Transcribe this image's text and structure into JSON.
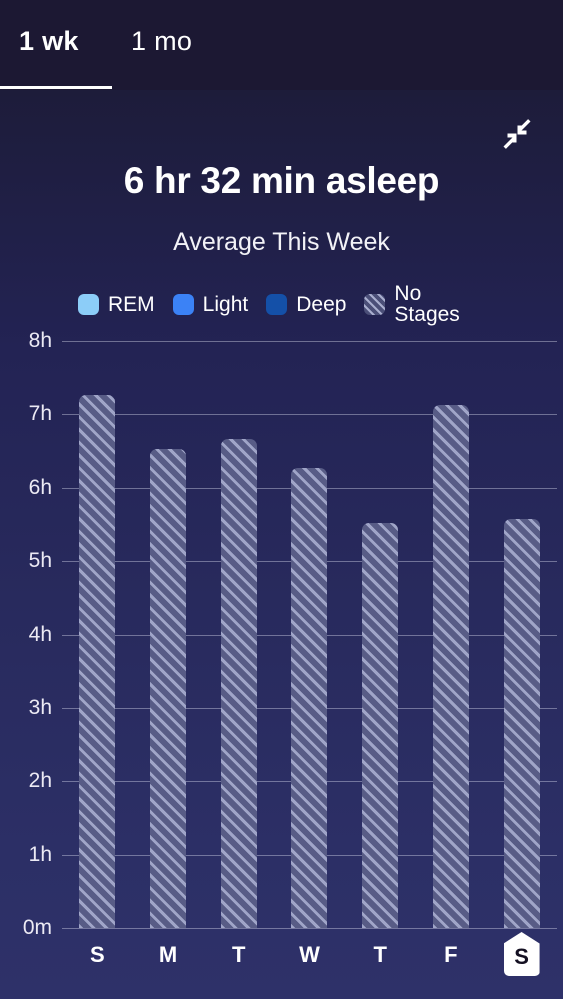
{
  "tabs": [
    {
      "label": "1 wk",
      "active": true
    },
    {
      "label": "1 mo",
      "active": false
    }
  ],
  "header": {
    "collapse_icon": "collapse-arrows-icon",
    "title": "6 hr 32 min asleep",
    "subtitle": "Average This Week"
  },
  "legend": [
    {
      "label": "REM",
      "color": "#8ccdf8",
      "pattern": "solid"
    },
    {
      "label": "Light",
      "color": "#3b82f6",
      "pattern": "solid"
    },
    {
      "label": "Deep",
      "color": "#1450a8",
      "pattern": "solid"
    },
    {
      "label": "No Stages",
      "color": "#4b4f78",
      "pattern": "hatched"
    }
  ],
  "chart_data": {
    "type": "bar",
    "title": "6 hr 32 min asleep",
    "subtitle": "Average This Week",
    "xlabel": "",
    "ylabel": "",
    "categories": [
      "S",
      "M",
      "T",
      "W",
      "T",
      "F",
      "S"
    ],
    "values": [
      7.27,
      6.53,
      6.67,
      6.27,
      5.52,
      7.13,
      5.58
    ],
    "value_unit": "hours",
    "ylim": [
      0,
      8
    ],
    "ytick_labels": [
      "0m",
      "1h",
      "2h",
      "3h",
      "4h",
      "5h",
      "6h",
      "7h",
      "8h"
    ],
    "ytick_values": [
      0,
      1,
      2,
      3,
      4,
      5,
      6,
      7,
      8
    ],
    "grid": true,
    "legend_position": "top",
    "series": [
      {
        "name": "No Stages",
        "values": [
          7.27,
          6.53,
          6.67,
          6.27,
          5.52,
          7.13,
          5.58
        ]
      }
    ],
    "highlighted_category_index": 6,
    "bar_color": "#585c86",
    "bar_pattern": "diagonal-hatch"
  }
}
